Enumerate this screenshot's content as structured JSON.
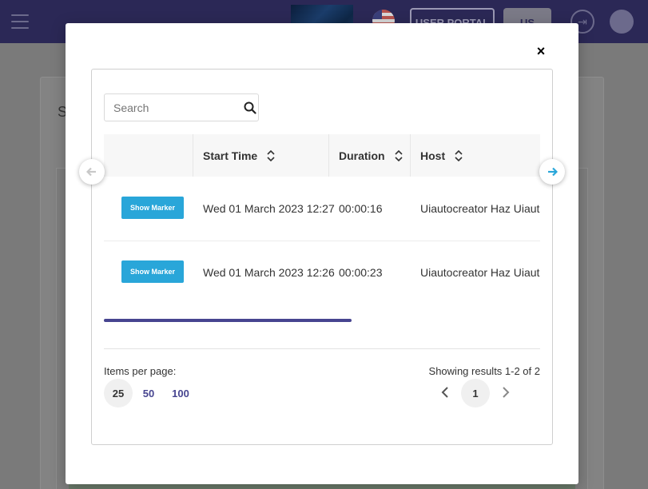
{
  "background": {
    "portal_button": "USER PORTAL",
    "language_button": "US",
    "card_title_initial": "S"
  },
  "modal": {
    "close_symbol": "×",
    "search": {
      "placeholder": "Search",
      "value": ""
    },
    "table": {
      "columns": [
        "Start Time",
        "Duration",
        "Host"
      ],
      "rows": [
        {
          "action": "Show Marker",
          "start_time": "Wed 01 March 2023 12:27",
          "duration": "00:00:16",
          "host": "Uiautocreator Haz Uiauto"
        },
        {
          "action": "Show Marker",
          "start_time": "Wed 01 March 2023 12:26",
          "duration": "00:00:23",
          "host": "Uiautocreator Haz Uiauto"
        }
      ]
    },
    "pagination": {
      "items_per_page_label": "Items per page:",
      "options": [
        "25",
        "50",
        "100"
      ],
      "selected": "25",
      "results_text": "Showing results 1-2 of 2",
      "current_page": "1"
    }
  },
  "colors": {
    "primary": "#474590",
    "marker_button": "#29a6d9",
    "nav_arrow_active": "#29a6d9",
    "topbar": "#2b2856"
  },
  "icons": {
    "search": "search-icon",
    "sort": "sort-icon",
    "prev_scroll": "arrow-left-icon",
    "next_scroll": "arrow-right-icon",
    "close": "close-icon",
    "page_prev": "chevron-left-icon",
    "page_next": "chevron-right-icon"
  }
}
